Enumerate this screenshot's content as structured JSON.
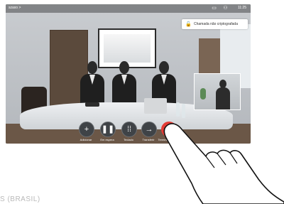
{
  "top_bar": {
    "room_name": "szaxo >",
    "time": "11:25"
  },
  "tooltip": {
    "text": "Chamada não criptografada"
  },
  "controls": [
    {
      "label": "Adicionar",
      "icon": "plus"
    },
    {
      "label": "Em espera",
      "icon": "pause"
    },
    {
      "label": "Teclado",
      "icon": "keypad"
    },
    {
      "label": "Transferir",
      "icon": "arrow-right"
    },
    {
      "label": "Terminar chamada",
      "icon": "close"
    }
  ],
  "caption": "S (BRASIL)",
  "colors": {
    "end_call": "#e43b35",
    "control_bg": "#3f4347"
  }
}
